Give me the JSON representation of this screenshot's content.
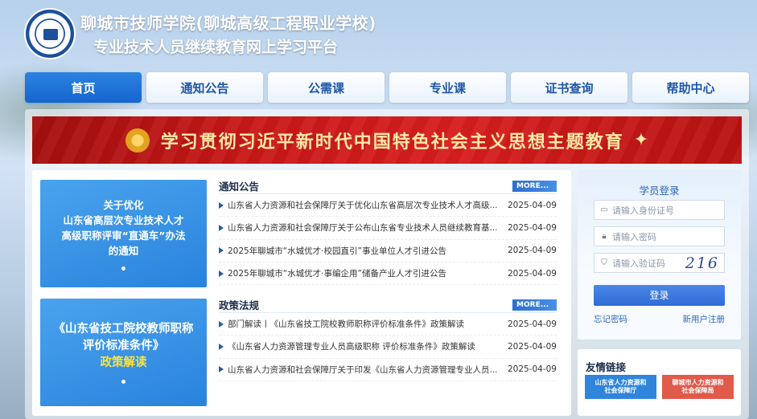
{
  "header": {
    "title_line1": "聊城市技师学院(聊城高级工程职业学校)",
    "title_line2": "专业技术人员继续教育网上学习平台",
    "logo_icon": "school-seal-icon"
  },
  "nav": {
    "items": [
      {
        "label": "首页"
      },
      {
        "label": "通知公告"
      },
      {
        "label": "公需课"
      },
      {
        "label": "专业课"
      },
      {
        "label": "证书查询"
      },
      {
        "label": "帮助中心"
      }
    ]
  },
  "banner": {
    "text": "学习贯彻习近平新时代中国特色社会主义思想主题教育"
  },
  "features": [
    {
      "lines": [
        "关于优化",
        "山东省高层次专业技术人才",
        "高级职称评审“直通车”办法",
        "的通知"
      ]
    },
    {
      "lines": [
        "《山东省技工院校教师职称",
        "评价标准条件》",
        "政策解读"
      ]
    }
  ],
  "notices": {
    "title": "通知公告",
    "more": "MORE...",
    "rows": [
      {
        "text": "山东省人力资源和社会保障厅关于优化山东省高层次专业技术人才高级...",
        "date": "2025-04-09"
      },
      {
        "text": "山东省人力资源和社会保障厅关于公布山东省专业技术人员继续教育基...",
        "date": "2025-04-09"
      },
      {
        "text": "2025年聊城市“水城优才·校园直引”事业单位人才引进公告",
        "date": "2025-04-09"
      },
      {
        "text": "2025年聊城市“水城优才·事编企用”储备产业人才引进公告",
        "date": "2025-04-09"
      }
    ]
  },
  "policies": {
    "title": "政策法规",
    "more": "MORE...",
    "rows": [
      {
        "text": "部门解读丨《山东省技工院校教师职称评价标准条件》政策解读",
        "date": "2025-04-09"
      },
      {
        "text": "《山东省人力资源管理专业人员高级职称 评价标准条件》政策解读",
        "date": "2025-04-09"
      },
      {
        "text": "山东省人力资源和社会保障厅关于印发《山东省人力资源管理专业人员...",
        "date": "2025-04-09"
      }
    ]
  },
  "login": {
    "title": "学员登录",
    "id_placeholder": "请输入身份证号",
    "password_placeholder": "请输入密码",
    "captcha_placeholder": "请输入验证码",
    "captcha_code": "216",
    "submit": "登录",
    "forgot": "忘记密码",
    "register": "新用户注册"
  },
  "friend_links": {
    "title": "友情链接",
    "items": [
      {
        "label_line1": "山东省人力资源和",
        "label_line2": "社会保障厅",
        "color": "#2f84dc"
      },
      {
        "label_line1": "聊城市人力资源和",
        "label_line2": "社会保障局",
        "color": "#e25a4a"
      }
    ]
  }
}
